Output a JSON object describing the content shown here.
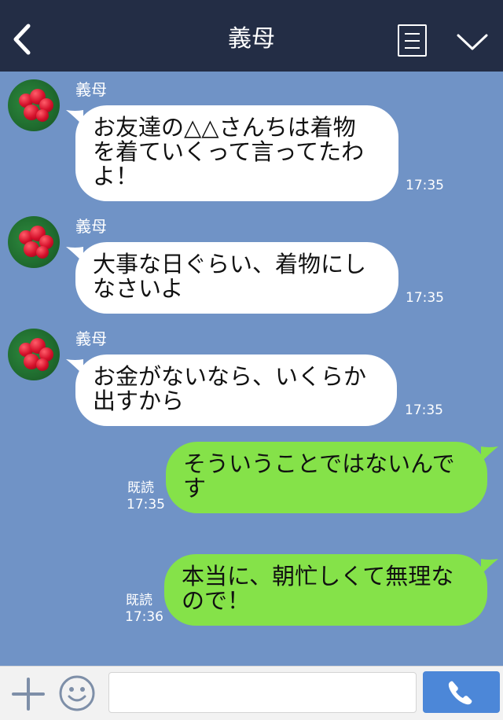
{
  "header": {
    "title": "義母",
    "back_icon": "chevron-left-icon",
    "menu_icon": "menu-icon",
    "expand_icon": "chevron-down-icon"
  },
  "messages": [
    {
      "direction": "in",
      "sender": "義母",
      "text": "お友達の△△さんちは着物\nを着ていくって言ってたわ\nよ！",
      "time": "17:35"
    },
    {
      "direction": "in",
      "sender": "義母",
      "text": "大事な日ぐらい、着物にし\nなさいよ",
      "time": "17:35"
    },
    {
      "direction": "in",
      "sender": "義母",
      "text": "お金がないなら、いくらか\n出すから",
      "time": "17:35"
    },
    {
      "direction": "out",
      "read": "既読",
      "text": "そういうことではないんで\nす",
      "time": "17:35"
    },
    {
      "direction": "out",
      "read": "既読",
      "text": "本当に、朝忙しくて無理な\nので！",
      "time": "17:36"
    }
  ],
  "inputbar": {
    "placeholder": "",
    "plus_icon": "plus-icon",
    "emoji_icon": "smiley-icon",
    "call_icon": "phone-icon"
  },
  "colors": {
    "header_bg": "#232d45",
    "chat_bg": "#7093c6",
    "incoming_bubble": "#ffffff",
    "outgoing_bubble": "#85e249",
    "call_button": "#4c87d8"
  }
}
